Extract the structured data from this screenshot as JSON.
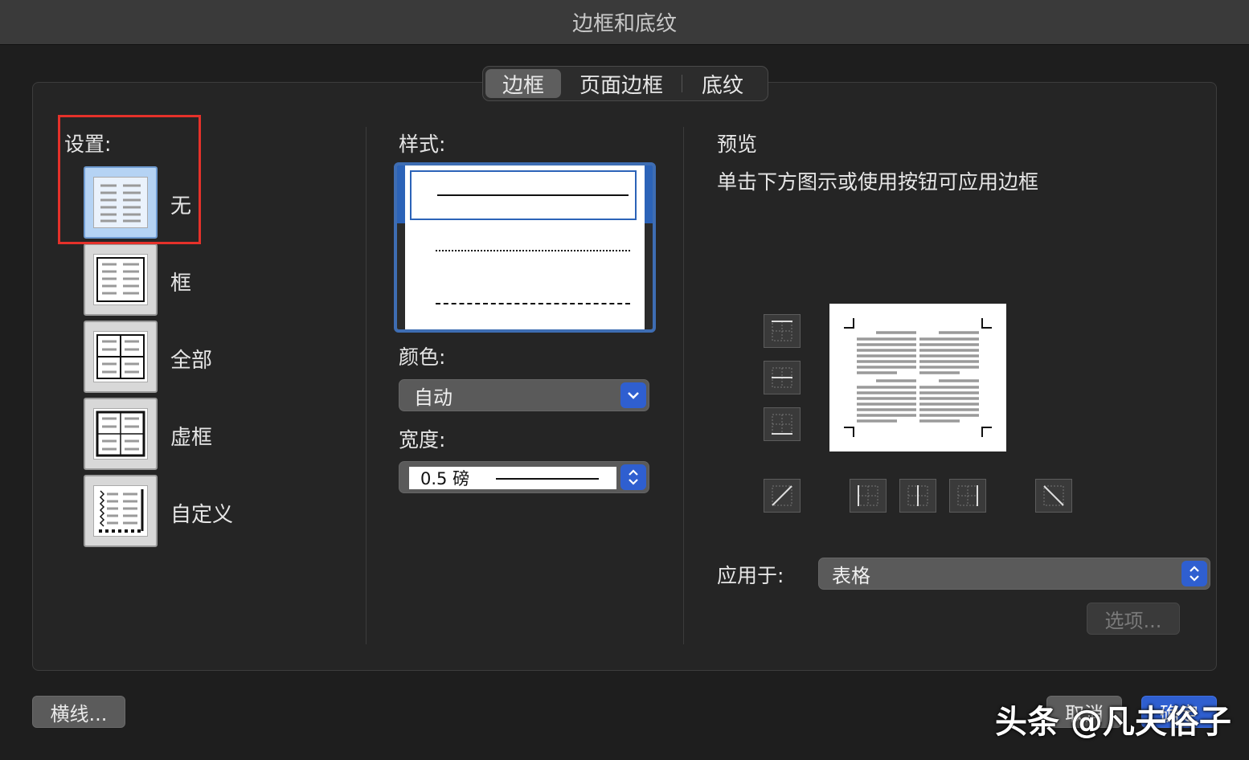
{
  "window": {
    "title": "边框和底纹"
  },
  "tabs": [
    {
      "label": "边框"
    },
    {
      "label": "页面边框"
    },
    {
      "label": "底纹"
    }
  ],
  "setting": {
    "label": "设置:",
    "options": [
      {
        "label": "无",
        "icon": "setting-none-icon",
        "selected": true
      },
      {
        "label": "框",
        "icon": "setting-box-icon"
      },
      {
        "label": "全部",
        "icon": "setting-all-icon"
      },
      {
        "label": "虚框",
        "icon": "setting-grid-icon"
      },
      {
        "label": "自定义",
        "icon": "setting-custom-icon"
      }
    ]
  },
  "style": {
    "label": "样式:",
    "items": [
      "solid",
      "dotted",
      "dashed"
    ],
    "selected": "solid"
  },
  "color": {
    "label": "颜色:",
    "value": "自动"
  },
  "width": {
    "label": "宽度:",
    "value": "0.5 磅"
  },
  "preview": {
    "title": "预览",
    "hint": "单击下方图示或使用按钮可应用边框"
  },
  "apply_to": {
    "label": "应用于:",
    "value": "表格"
  },
  "buttons": {
    "options": "选项...",
    "horizontal_line": "横线...",
    "cancel": "取消",
    "ok": "确定"
  },
  "watermark": "头条 @凡夫俗子",
  "colors": {
    "accent": "#2f5fd0",
    "highlight": "#e5312a",
    "selected_bg": "#b5d3f4"
  }
}
